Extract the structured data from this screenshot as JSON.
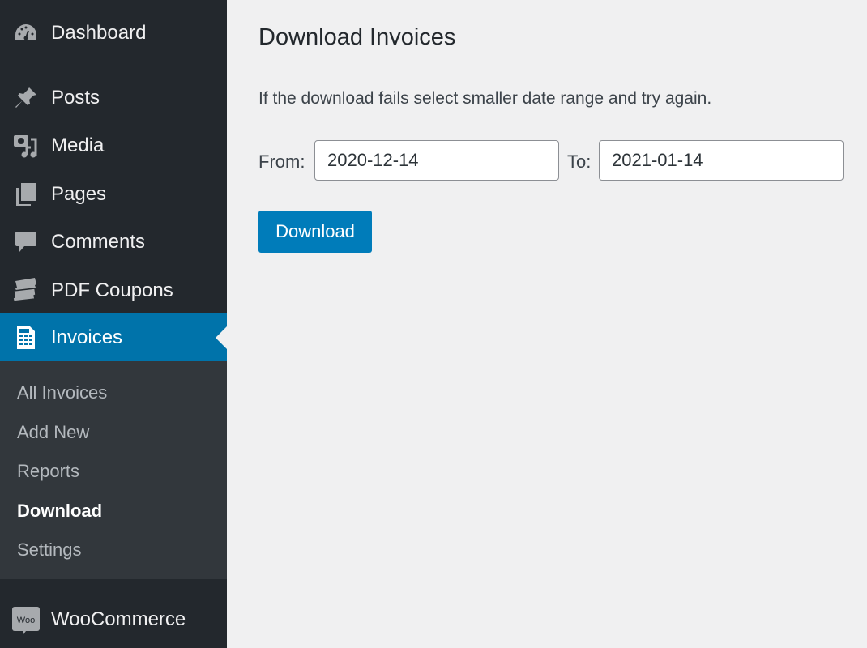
{
  "sidebar": {
    "items": [
      {
        "label": "Dashboard",
        "icon": "dashboard-icon"
      },
      {
        "label": "Posts",
        "icon": "pin-icon"
      },
      {
        "label": "Media",
        "icon": "media-icon"
      },
      {
        "label": "Pages",
        "icon": "pages-icon"
      },
      {
        "label": "Comments",
        "icon": "comment-icon"
      },
      {
        "label": "PDF Coupons",
        "icon": "tickets-icon"
      },
      {
        "label": "Invoices",
        "icon": "invoice-icon",
        "active": true
      },
      {
        "label": "WooCommerce",
        "icon": "woo-icon"
      }
    ],
    "submenu": [
      {
        "label": "All Invoices"
      },
      {
        "label": "Add New"
      },
      {
        "label": "Reports"
      },
      {
        "label": "Download",
        "current": true
      },
      {
        "label": "Settings"
      }
    ],
    "woo_badge": "Woo"
  },
  "main": {
    "title": "Download Invoices",
    "description": "If the download fails select smaller date range and try again.",
    "from_label": "From:",
    "from_value": "2020-12-14",
    "to_label": "To:",
    "to_value": "2021-01-14",
    "download_button": "Download"
  },
  "colors": {
    "accent": "#0073aa",
    "button": "#007cba",
    "sidebar": "#23282d",
    "submenu": "#32373c"
  }
}
